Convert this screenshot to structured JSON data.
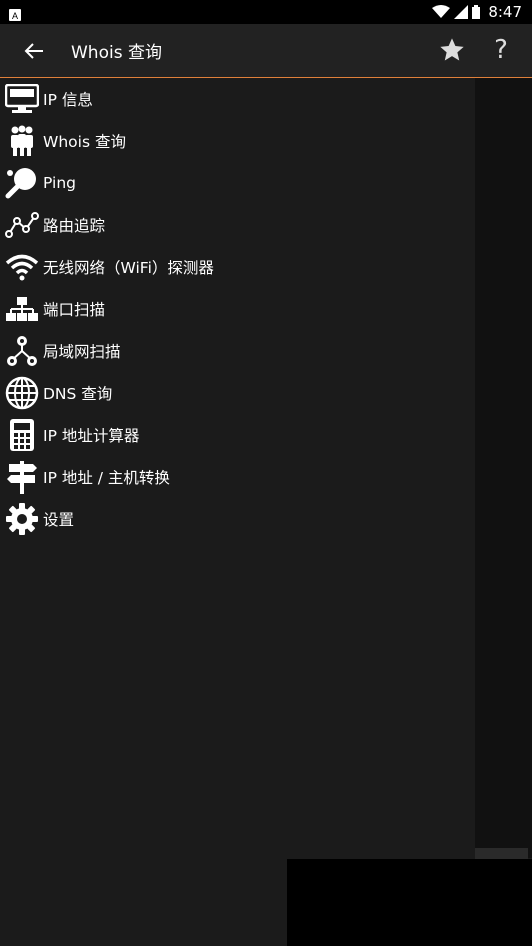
{
  "status": {
    "time": "8:47"
  },
  "appbar": {
    "title": "Whois 查询"
  },
  "menu": [
    {
      "label": "IP 信息",
      "icon": "monitor-icon"
    },
    {
      "label": "Whois 查询",
      "icon": "people-icon"
    },
    {
      "label": "Ping",
      "icon": "ping-pong-icon"
    },
    {
      "label": "路由追踪",
      "icon": "route-icon"
    },
    {
      "label": "无线网络（WiFi）探测器",
      "icon": "wifi-icon"
    },
    {
      "label": "端口扫描",
      "icon": "network-icon"
    },
    {
      "label": "局域网扫描",
      "icon": "lan-icon"
    },
    {
      "label": "DNS 查询",
      "icon": "globe-icon"
    },
    {
      "label": "IP 地址计算器",
      "icon": "calculator-icon"
    },
    {
      "label": "IP 地址 / 主机转换",
      "icon": "signpost-icon"
    },
    {
      "label": "设置",
      "icon": "gear-icon"
    }
  ]
}
